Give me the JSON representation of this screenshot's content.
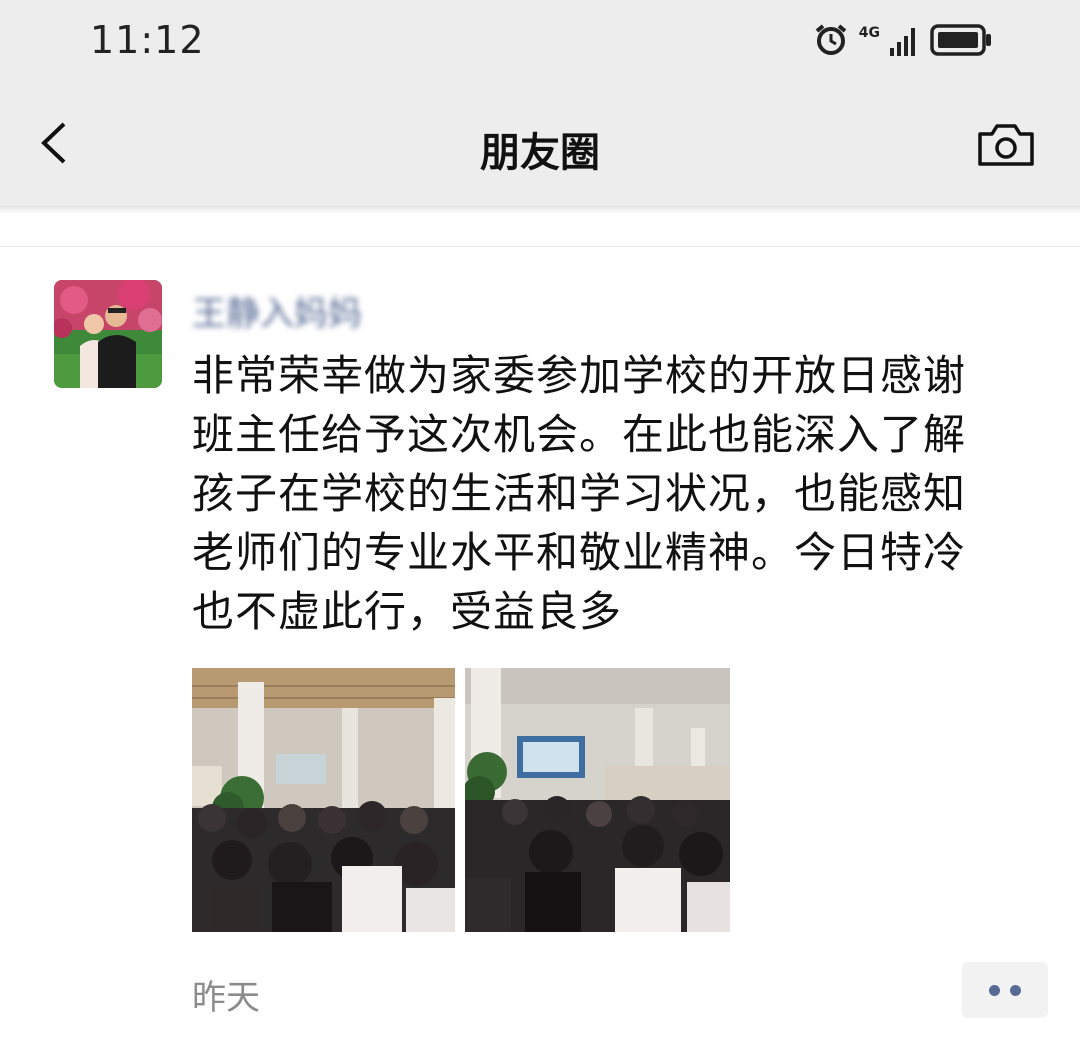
{
  "status_bar": {
    "time": "11:12",
    "network": "4G",
    "icons": [
      "alarm-icon",
      "signal-icon",
      "battery-icon"
    ]
  },
  "nav": {
    "title": "朋友圈",
    "back_icon": "chevron-left-icon",
    "camera_icon": "camera-icon"
  },
  "post": {
    "author": "王静入妈妈",
    "text": "非常荣幸做为家委参加学校的开放日感谢\n班主任给予这次机会。在此也能深入了解\n孩子在学校的生活和学习状况，也能感知\n老师们的专业水平和敬业精神。今日特冷\n也不虚此行，受益良多",
    "photo_count": 2,
    "timestamp": "昨天",
    "more_icon": "more-dots-icon"
  },
  "colors": {
    "header_bg": "#ededed",
    "name_color": "#576b95",
    "text_color": "#111111",
    "time_color": "#8c8c8c"
  }
}
